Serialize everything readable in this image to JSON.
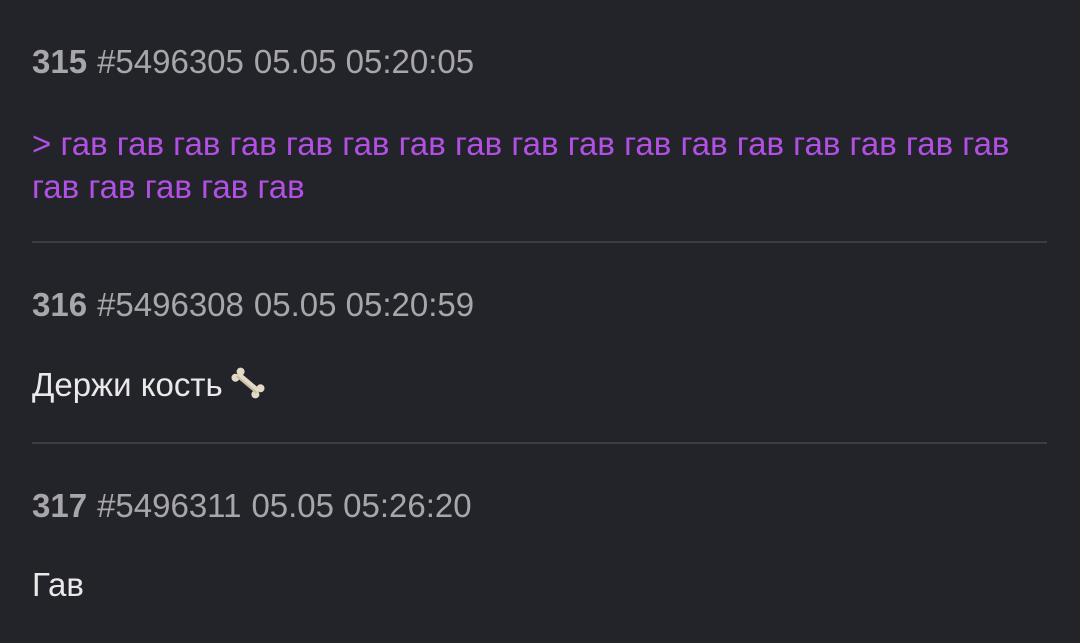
{
  "posts": [
    {
      "number": "315",
      "id": "#5496305",
      "date": "05.05 05:20:05",
      "quote": "> гав гав гав гав гав гав гав гав гав гав гав гав гав гав гав гав гав гав гав гав гав гав"
    },
    {
      "number": "316",
      "id": "#5496308",
      "date": "05.05 05:20:59",
      "text": "Держи кость",
      "emoji": "bone-icon"
    },
    {
      "number": "317",
      "id": "#5496311",
      "date": "05.05 05:26:20",
      "text": "Гав"
    }
  ],
  "colors": {
    "background": "#23232a",
    "header_text": "#a7a7ab",
    "body_text": "#e9e9ea",
    "quote_text": "#b150e2",
    "divider": "#3c3c44"
  }
}
